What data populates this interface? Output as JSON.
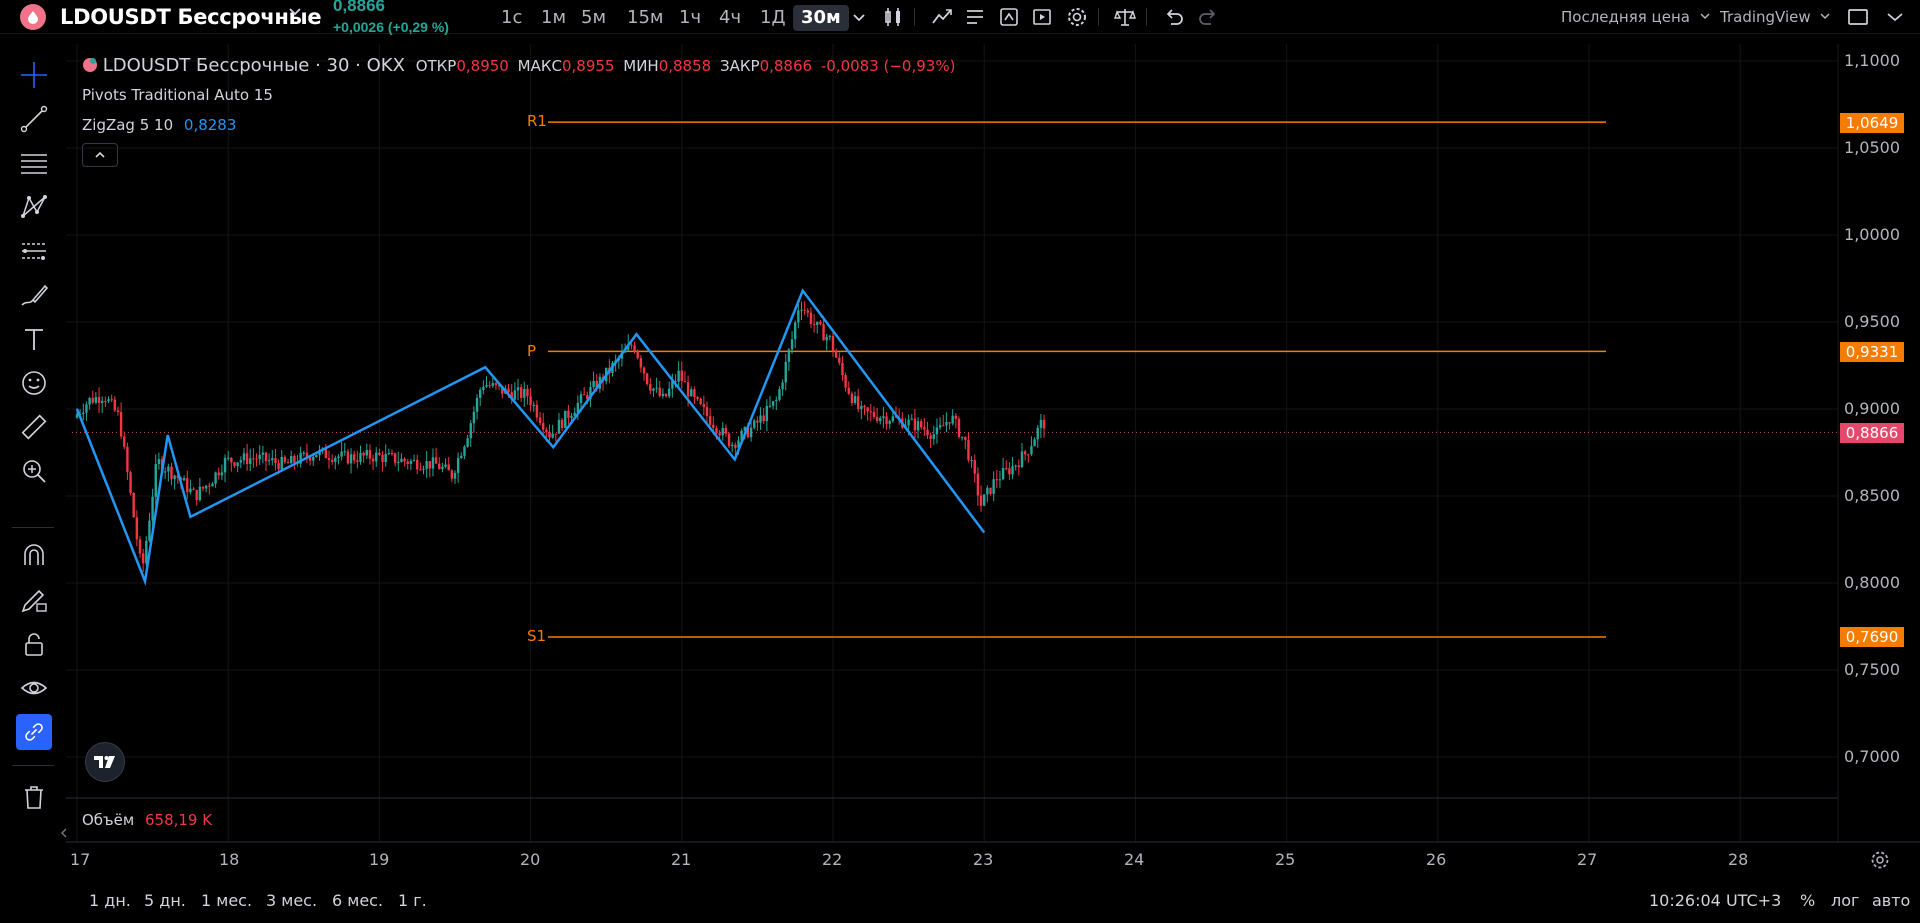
{
  "header": {
    "symbol": "LDOUSDT Бессрочные",
    "last_price": "0,8866",
    "change": "+0,0026 (+0,29 %)",
    "timeframes": [
      "1с",
      "1м",
      "5м",
      "15м",
      "1ч",
      "4ч",
      "1Д",
      "30м"
    ],
    "active_timeframe": "30м",
    "price_type_menu": "Последняя цена",
    "source_menu": "TradingView"
  },
  "legend": {
    "title": "LDOUSDT Бессрочные · 30 · OKX",
    "open_label": "ОТКР",
    "open": "0,8950",
    "high_label": "МАКС",
    "high": "0,8955",
    "low_label": "МИН",
    "low": "0,8858",
    "close_label": "ЗАКР",
    "close": "0,8866",
    "change": "-0,0083 (−0,93%)",
    "indicator1": "Pivots Traditional Auto 15",
    "indicator2": "ZigZag 5 10",
    "indicator2_value": "0,8283"
  },
  "pivots": {
    "r1_label": "R1",
    "p_label": "P",
    "s1_label": "S1"
  },
  "price_axis": [
    "1,1000",
    "1,0500",
    "1,0000",
    "0,9500",
    "0,9000",
    "0,8500",
    "0,8000",
    "0,7500",
    "0,7000"
  ],
  "price_tags": {
    "r1": "1,0649",
    "p": "0,9331",
    "last": "0,8866",
    "s1": "0,7690"
  },
  "time_axis": [
    "17",
    "18",
    "19",
    "20",
    "21",
    "22",
    "23",
    "24",
    "25",
    "26",
    "27",
    "28"
  ],
  "volume": {
    "label": "Объём",
    "value": "658,19 K"
  },
  "bottom": {
    "ranges": [
      "1 дн.",
      "5 дн.",
      "1 мес.",
      "3 мес.",
      "6 мес.",
      "1 г."
    ],
    "clock": "10:26:04 UTC+3",
    "percent": "%",
    "log": "лог",
    "auto": "авто"
  },
  "colors": {
    "up": "#26a69a",
    "down": "#f23645",
    "pivot": "#f57c00",
    "zigzag": "#2196f3",
    "last_price": "#e5486a",
    "active": "#2962ff"
  },
  "chart_data": {
    "type": "line",
    "title": "LDOUSDT Бессрочные · 30 · OKX",
    "x_unit": "day of month",
    "y_range": [
      0.68,
      1.11
    ],
    "pivots": {
      "R1": 1.0649,
      "P": 0.9331,
      "S1": 0.769
    },
    "last_price": 0.8866,
    "zigzag": {
      "x": [
        17.0,
        17.45,
        17.6,
        17.75,
        19.7,
        20.15,
        20.7,
        21.35,
        21.8,
        23.0
      ],
      "y": [
        0.9,
        0.801,
        0.885,
        0.838,
        0.924,
        0.878,
        0.943,
        0.871,
        0.968,
        0.829
      ]
    },
    "price_path": {
      "x": [
        17.0,
        17.1,
        17.2,
        17.3,
        17.45,
        17.55,
        17.7,
        17.8,
        17.9,
        18.0,
        18.2,
        18.4,
        18.6,
        18.8,
        19.0,
        19.2,
        19.4,
        19.5,
        19.6,
        19.7,
        19.85,
        20.0,
        20.15,
        20.3,
        20.5,
        20.7,
        20.8,
        20.9,
        21.0,
        21.1,
        21.25,
        21.35,
        21.5,
        21.65,
        21.75,
        21.8,
        21.9,
        22.0,
        22.1,
        22.2,
        22.4,
        22.6,
        22.7,
        22.8,
        22.9,
        23.0,
        23.1,
        23.2,
        23.3,
        23.4
      ],
      "y": [
        0.895,
        0.905,
        0.908,
        0.895,
        0.806,
        0.87,
        0.86,
        0.85,
        0.858,
        0.87,
        0.872,
        0.868,
        0.875,
        0.872,
        0.873,
        0.87,
        0.868,
        0.862,
        0.885,
        0.915,
        0.91,
        0.908,
        0.885,
        0.9,
        0.918,
        0.938,
        0.915,
        0.905,
        0.92,
        0.905,
        0.89,
        0.88,
        0.89,
        0.905,
        0.94,
        0.962,
        0.948,
        0.94,
        0.915,
        0.898,
        0.895,
        0.89,
        0.885,
        0.896,
        0.88,
        0.845,
        0.86,
        0.866,
        0.875,
        0.892
      ]
    }
  }
}
